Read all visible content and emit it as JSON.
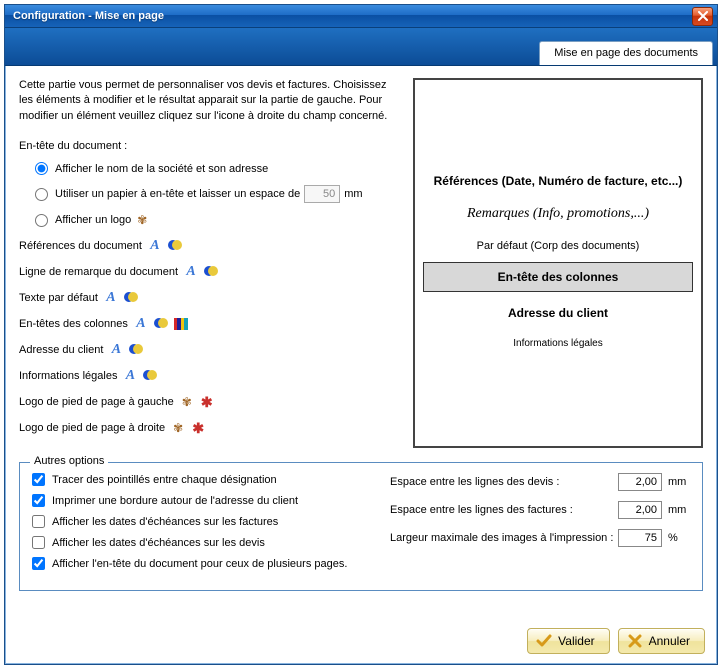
{
  "window": {
    "title": "Configuration - Mise en page"
  },
  "tab": {
    "label": "Mise en page des documents"
  },
  "intro": "Cette partie vous permet de personnaliser vos devis et factures. Choisissez les éléments à modifier et le résultat apparait sur la partie de gauche. Pour modifier un élément veuillez cliquez sur l'icone à droite du champ concerné.",
  "doc_header": {
    "label": "En-tête du document :",
    "opt_company": "Afficher le nom de la société et son adresse",
    "opt_paper_prefix": "Utiliser un papier à en-tête et laisser un espace de",
    "opt_paper_value": "50",
    "opt_paper_unit": "mm",
    "opt_logo": "Afficher un logo"
  },
  "items": {
    "references": "Références du document",
    "remark": "Ligne de remarque du document",
    "default_text": "Texte par défaut",
    "col_headers": "En-têtes des colonnes",
    "client_addr": "Adresse du client",
    "legal": "Informations légales",
    "footer_logo_left": "Logo de pied de page à gauche",
    "footer_logo_right": "Logo de pied de page à droite"
  },
  "preview": {
    "references": "Références (Date, Numéro de facture, etc...)",
    "remarks": "Remarques (Info, promotions,...)",
    "default_body": "Par défaut (Corp des documents)",
    "col_header": "En-tête des colonnes",
    "client_addr": "Adresse du client",
    "legal": "Informations légales"
  },
  "other": {
    "legend": "Autres options",
    "chk_dotted": "Tracer des pointillés entre chaque désignation",
    "chk_border": "Imprimer une bordure autour de l'adresse du client",
    "chk_due_inv": "Afficher les dates d'échéances sur les factures",
    "chk_due_quote": "Afficher les dates d'échéances sur les devis",
    "chk_header_multi": "Afficher l'en-tête du document pour ceux de plusieurs pages.",
    "spacing_quote_lbl": "Espace entre les lignes des devis :",
    "spacing_quote_val": "2,00",
    "spacing_inv_lbl": "Espace entre les lignes des factures :",
    "spacing_inv_val": "2,00",
    "img_width_lbl": "Largeur maximale des images à l'impression :",
    "img_width_val": "75",
    "unit_mm": "mm",
    "unit_pct": "%"
  },
  "buttons": {
    "ok": "Valider",
    "cancel": "Annuler"
  }
}
